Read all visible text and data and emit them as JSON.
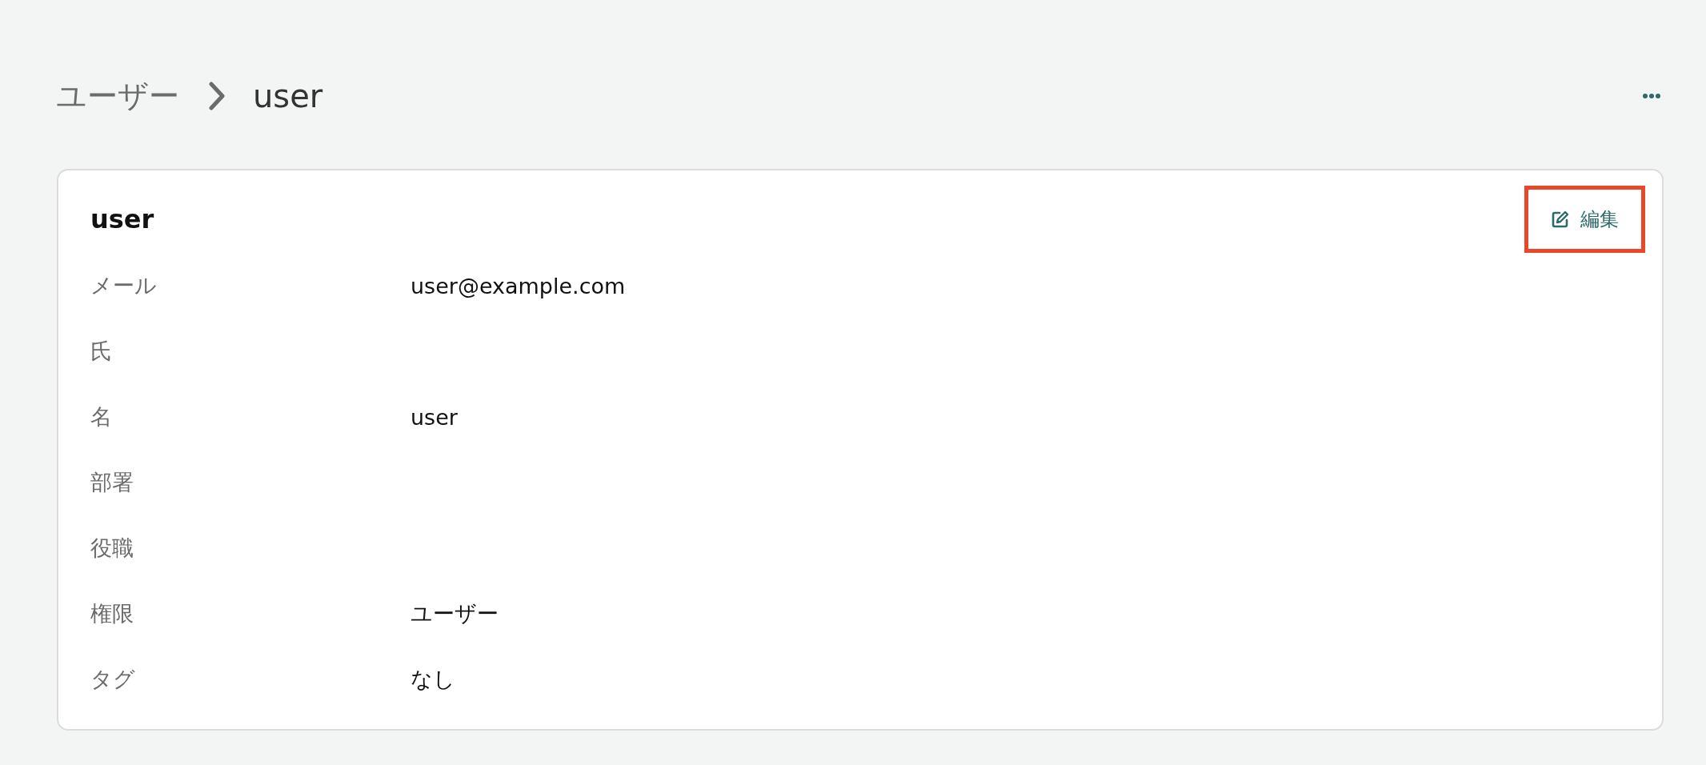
{
  "breadcrumb": {
    "parent": "ユーザー",
    "current": "user"
  },
  "card": {
    "title": "user",
    "edit_button": {
      "label": "編集",
      "highlighted": true
    },
    "fields": [
      {
        "label": "メール",
        "value": "user@example.com"
      },
      {
        "label": "氏"
      },
      {
        "label": "名",
        "value": "user"
      },
      {
        "label": "部署"
      },
      {
        "label": "役職"
      },
      {
        "label": "権限",
        "value": "ユーザー"
      },
      {
        "label": "タグ",
        "value": "なし"
      }
    ]
  }
}
